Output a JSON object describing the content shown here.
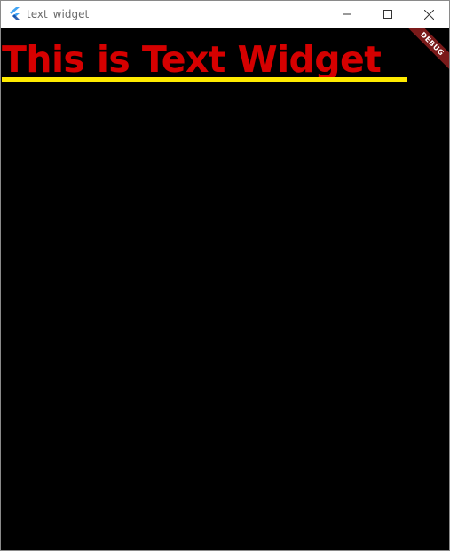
{
  "window": {
    "title": "text_widget",
    "app_icon": "flutter-icon",
    "controls": {
      "minimize_icon": "minimize-icon",
      "maximize_icon": "maximize-icon",
      "close_icon": "close-icon"
    }
  },
  "content": {
    "headline": "This is Text Widget",
    "headline_color": "#d50000",
    "underline_color": "#ffeb00",
    "background_color": "#000000",
    "debug_banner": "DEBUG"
  }
}
